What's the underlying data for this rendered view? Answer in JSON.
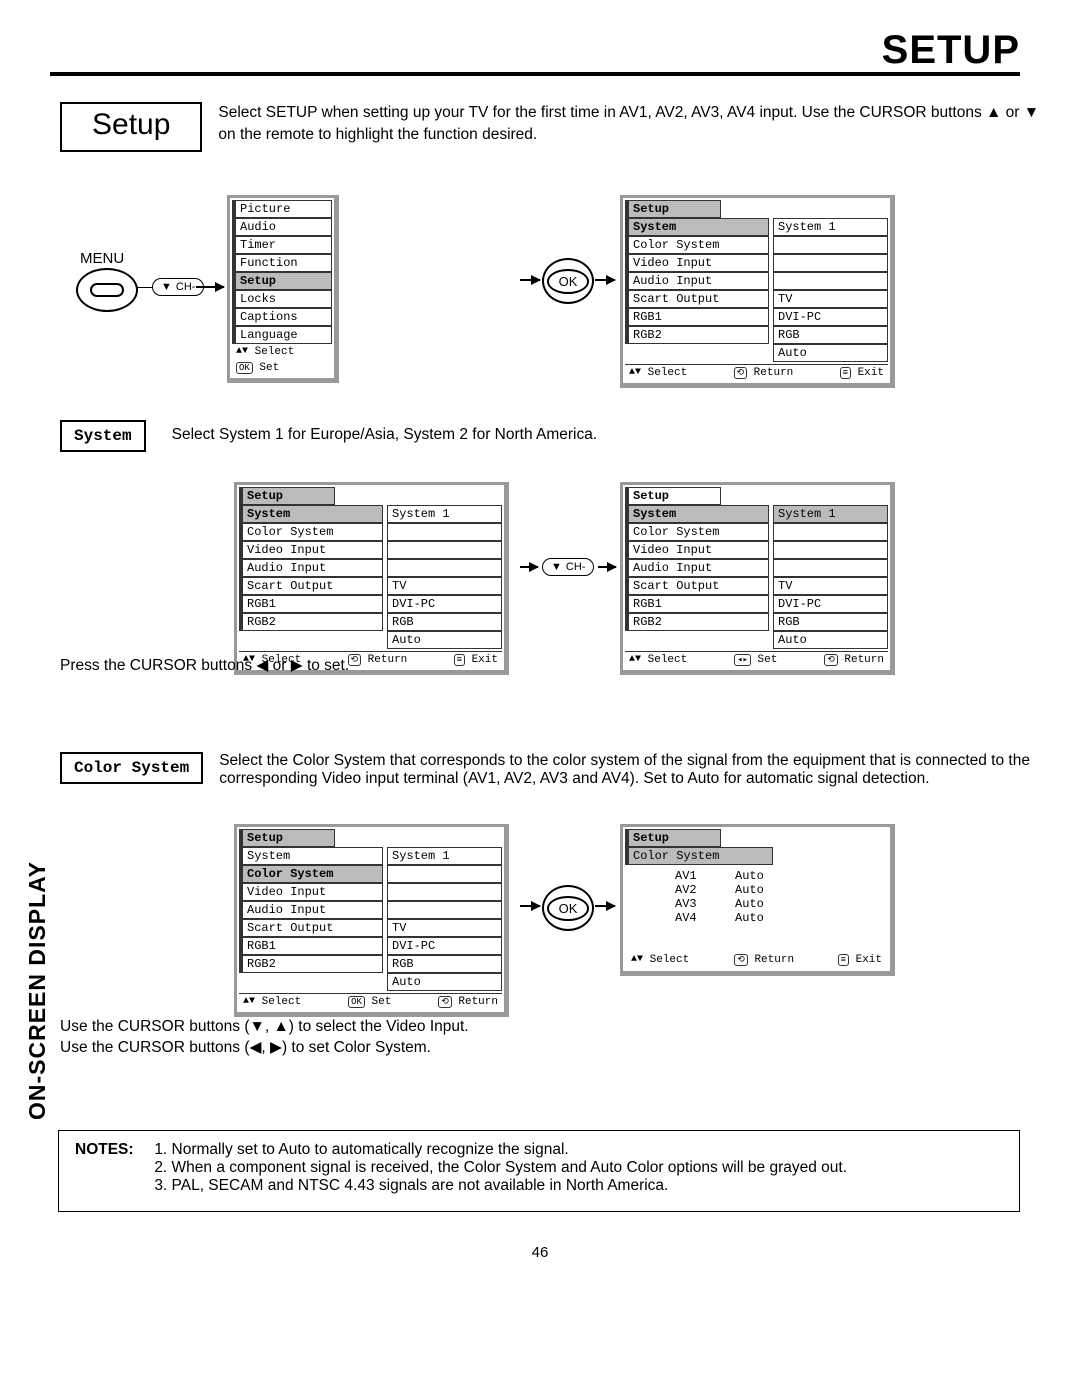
{
  "header": {
    "title": "SETUP"
  },
  "section_setup": {
    "box_label": "Setup",
    "body": "Select SETUP when setting up your TV for the first time in AV1, AV2, AV3, AV4 input. Use the CURSOR buttons ▲ or ▼ on the remote to highlight the function desired."
  },
  "menu_label": "MENU",
  "menu_panel": {
    "items": [
      "Picture",
      "Audio",
      "Timer",
      "Function",
      "Setup",
      "Locks",
      "Captions",
      "Language"
    ],
    "selected_index": 4,
    "footer_select": "Select",
    "footer_set": "Set",
    "footer_set_icon": "OK"
  },
  "setup_right_panel": {
    "title": "Setup",
    "rows": [
      {
        "label": "System",
        "val": "System 1",
        "sel": true
      },
      {
        "label": "Color System",
        "val": ""
      },
      {
        "label": "Video Input",
        "val": ""
      },
      {
        "label": "Audio Input",
        "val": ""
      },
      {
        "label": "Scart Output",
        "val": "TV"
      },
      {
        "label": "RGB1",
        "val": "DVI-PC"
      },
      {
        "label": "RGB2",
        "val": "RGB"
      },
      {
        "label": "",
        "val": "Auto",
        "spacer": true
      }
    ],
    "footer": {
      "a": "Select",
      "b": "Return",
      "c": "Exit"
    }
  },
  "ok_label": "OK",
  "section_system": {
    "box_label": "System",
    "body": "Select System 1 for Europe/Asia, System 2 for North America."
  },
  "system_left_panel": {
    "title": "Setup",
    "title_sel": true,
    "rows": [
      {
        "label": "System",
        "val": "System 1",
        "sel": true,
        "valsel": false
      },
      {
        "label": "Color System",
        "val": ""
      },
      {
        "label": "Video Input",
        "val": ""
      },
      {
        "label": "Audio Input",
        "val": ""
      },
      {
        "label": "Scart Output",
        "val": "TV"
      },
      {
        "label": "RGB1",
        "val": "DVI-PC"
      },
      {
        "label": "RGB2",
        "val": "RGB"
      },
      {
        "label": "",
        "val": "Auto",
        "spacer": true
      }
    ],
    "footer": {
      "a": "Select",
      "b": "Return",
      "c": "Exit"
    }
  },
  "system_right_panel": {
    "title": "Setup",
    "title_sel": false,
    "rows": [
      {
        "label": "System",
        "val": "System 1",
        "sel": true,
        "valsel": true
      },
      {
        "label": "Color System",
        "val": ""
      },
      {
        "label": "Video Input",
        "val": ""
      },
      {
        "label": "Audio Input",
        "val": ""
      },
      {
        "label": "Scart Output",
        "val": "TV"
      },
      {
        "label": "RGB1",
        "val": "DVI-PC"
      },
      {
        "label": "RGB2",
        "val": "RGB"
      },
      {
        "label": "",
        "val": "Auto",
        "spacer": true
      }
    ],
    "footer": {
      "a": "Select",
      "b": "Set",
      "c": "Return",
      "b_icon": "◂▸"
    }
  },
  "ch_label": "CH-",
  "press_cursor_text": "Press the CURSOR buttons ◀ or ▶ to set.",
  "section_color": {
    "box_label": "Color System",
    "body": "Select the Color System that corresponds to the color system of the signal from the equipment that is connected to the corresponding Video input terminal (AV1, AV2, AV3 and AV4). Set to Auto for automatic signal detection."
  },
  "color_left_panel": {
    "title": "Setup",
    "title_sel": true,
    "rows": [
      {
        "label": "System",
        "val": "System 1"
      },
      {
        "label": "Color System",
        "val": "",
        "sel": true
      },
      {
        "label": "Video Input",
        "val": ""
      },
      {
        "label": "Audio Input",
        "val": ""
      },
      {
        "label": "Scart Output",
        "val": "TV"
      },
      {
        "label": "RGB1",
        "val": "DVI-PC"
      },
      {
        "label": "RGB2",
        "val": "RGB"
      },
      {
        "label": "",
        "val": "Auto",
        "spacer": true
      }
    ],
    "footer": {
      "a": "Select",
      "b": "Set",
      "c": "Return",
      "b_icon": "OK"
    }
  },
  "color_right_panel": {
    "title": "Setup",
    "subtitle": "Color System",
    "items": [
      {
        "label": "AV1",
        "val": "Auto"
      },
      {
        "label": "AV2",
        "val": "Auto"
      },
      {
        "label": "AV3",
        "val": "Auto"
      },
      {
        "label": "AV4",
        "val": "Auto"
      }
    ],
    "footer": {
      "a": "Select",
      "b": "Return",
      "c": "Exit"
    }
  },
  "use_cursor_1": "Use the CURSOR buttons (▼, ▲) to select the Video Input.",
  "use_cursor_2": "Use the CURSOR buttons (◀, ▶) to set Color System.",
  "notes_label": "NOTES:",
  "notes": [
    "1. Normally set to Auto to automatically recognize the signal.",
    "2. When a component signal is received, the Color System and Auto Color options will be grayed out.",
    "3. PAL, SECAM and NTSC 4.43 signals are not available in North America."
  ],
  "sidebar": "ON-SCREEN DISPLAY",
  "page_number": "46"
}
